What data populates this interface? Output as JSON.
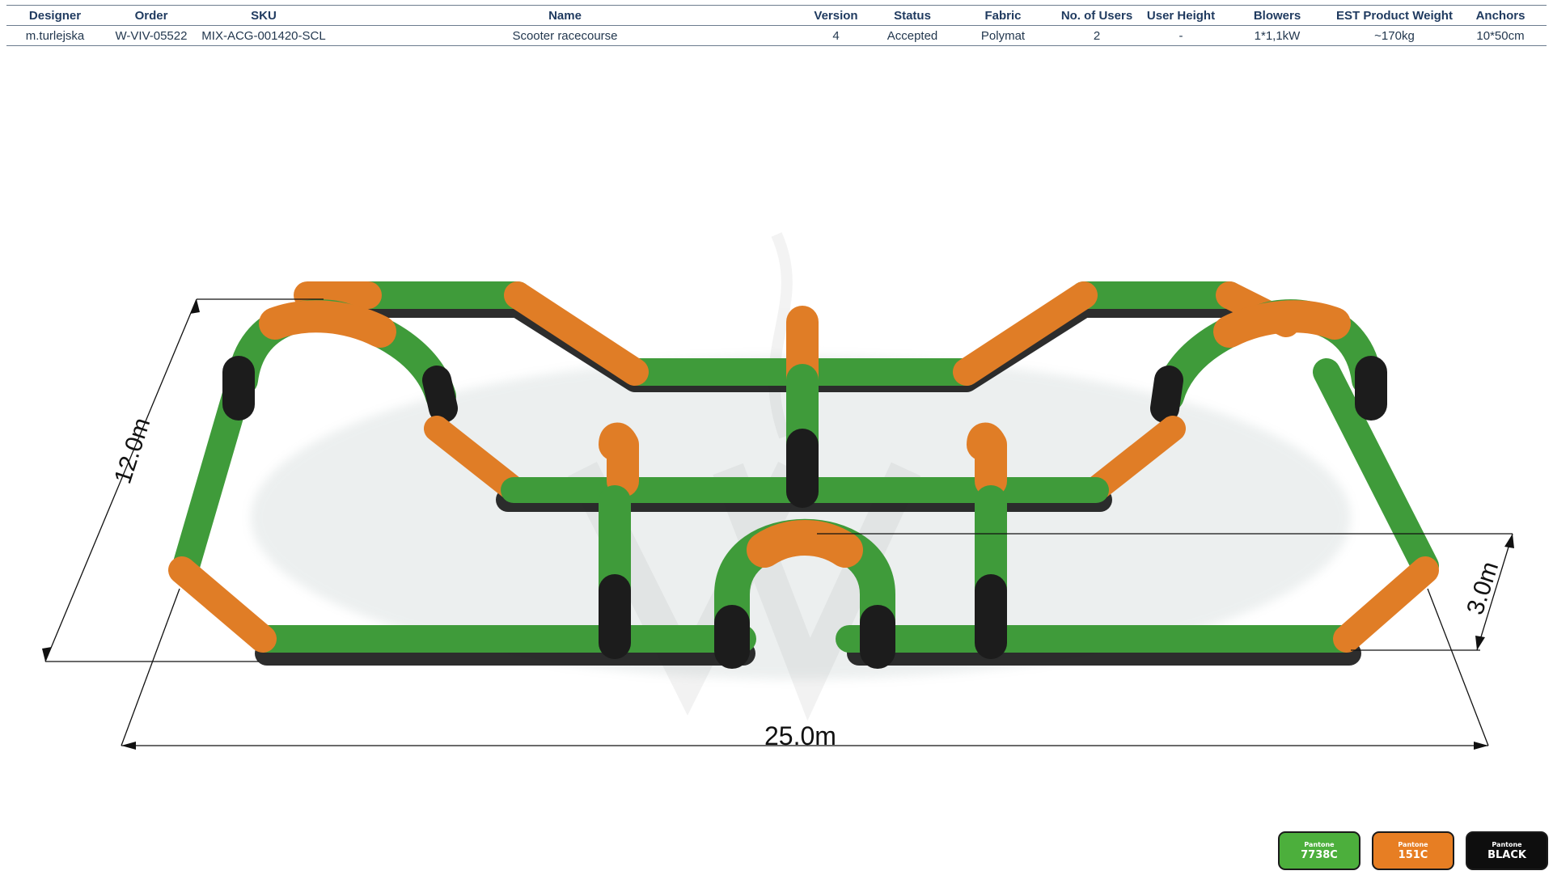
{
  "spec": {
    "headers": [
      "Designer",
      "Order",
      "SKU",
      "Name",
      "Version",
      "Status",
      "Fabric",
      "No. of Users",
      "User  Height",
      "Blowers",
      "EST Product Weight",
      "Anchors"
    ],
    "row": [
      "m.turlejska",
      "W-VIV-05522",
      "MIX-ACG-001420-SCL",
      "Scooter racecourse",
      "4",
      "Accepted",
      "Polymat",
      "2",
      "-",
      "1*1,1kW",
      "~170kg",
      "10*50cm"
    ]
  },
  "dimensions": {
    "depth": "12.0m",
    "width": "25.0m",
    "height": "3.0m"
  },
  "colors": {
    "green": "#3f9b3a",
    "orange": "#e07d26",
    "black": "#1c1c1c"
  },
  "swatches": [
    {
      "prefix": "Pantone",
      "code": "7738C",
      "color": "#4caf3c"
    },
    {
      "prefix": "Pantone",
      "code": "151C",
      "color": "#e77e23"
    },
    {
      "prefix": "Pantone",
      "code": "BLACK",
      "color": "#0e0e0e"
    }
  ]
}
